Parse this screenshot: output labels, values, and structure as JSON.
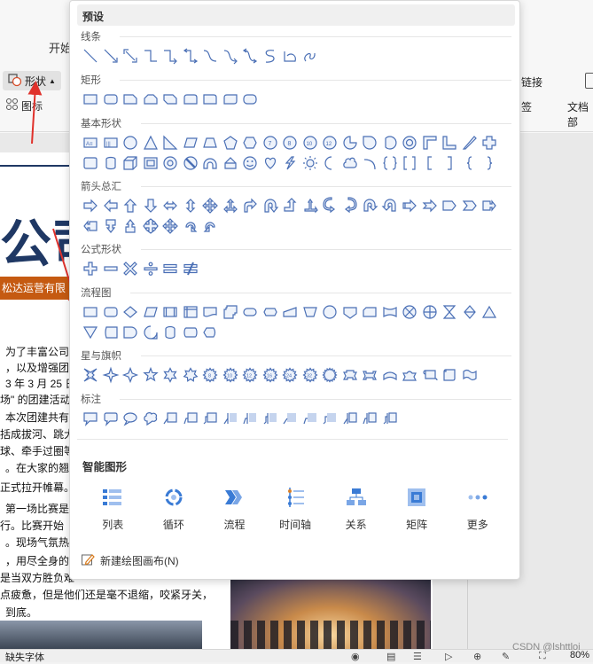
{
  "ribbon": {
    "tab_start": "开始",
    "shape_button": "形状",
    "chart_button": "图标",
    "link_label": "链接",
    "sign_label": "签",
    "doc_label": "文档部"
  },
  "document": {
    "big_title": "公司",
    "orange_banner": "松达运营有限",
    "paragraph_lines": [
      "为了丰富公司",
      "，以及增强团队",
      "3 年 3 月 25 日",
      "场\" 的团建活动",
      "本次团建共有",
      "括成拔河、跳大",
      "球、牵手过圈等",
      "。在大家的翘首",
      "正式拉开帷幕。",
      "第一场比赛是",
      "行。比赛开始",
      "。现场气氛热烈",
      "，用尽全身的",
      "是当双方胜负难",
      "点疲惫，但是他们还是毫不退缩，咬紧牙关，",
      "到底。"
    ]
  },
  "status": {
    "font_hint": "缺失字体",
    "zoom": "80%",
    "watermark": "CSDN @lshttloi"
  },
  "panel": {
    "title": "预设",
    "sections": [
      {
        "label": "线条",
        "count": 12,
        "kind": "line"
      },
      {
        "label": "矩形",
        "count": 9,
        "kind": "rect"
      },
      {
        "label": "基本形状",
        "count": 42,
        "kind": "basic"
      },
      {
        "label": "箭头总汇",
        "count": 28,
        "kind": "arrow"
      },
      {
        "label": "公式形状",
        "count": 6,
        "kind": "formula"
      },
      {
        "label": "流程图",
        "count": 28,
        "kind": "flow"
      },
      {
        "label": "星与旗帜",
        "count": 20,
        "kind": "star"
      },
      {
        "label": "标注",
        "count": 16,
        "kind": "callout"
      }
    ],
    "smart_title": "智能图形",
    "smart_items": [
      {
        "label": "列表",
        "icon": "list-icon"
      },
      {
        "label": "循环",
        "icon": "cycle-icon"
      },
      {
        "label": "流程",
        "icon": "process-icon"
      },
      {
        "label": "时间轴",
        "icon": "timeline-icon"
      },
      {
        "label": "关系",
        "icon": "relation-icon"
      },
      {
        "label": "矩阵",
        "icon": "matrix-icon"
      },
      {
        "label": "更多",
        "icon": "more-icon"
      }
    ],
    "new_canvas": "新建绘图画布(N)"
  },
  "colors": {
    "shape_stroke": "#4a6fb5",
    "accent": "#3a7bd5",
    "title_blue": "#1f3864",
    "banner_orange": "#c55a11",
    "arrow_red": "#e0312b"
  }
}
